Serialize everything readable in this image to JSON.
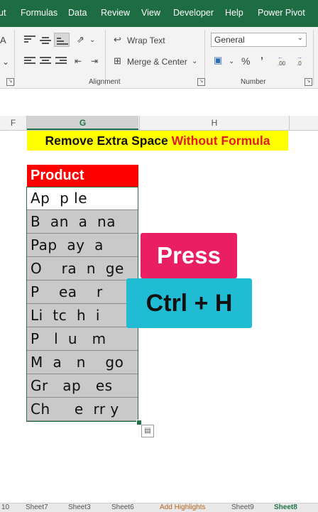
{
  "menu": {
    "tabs": [
      "ut",
      "Formulas",
      "Data",
      "Review",
      "View",
      "Developer",
      "Help",
      "Power Pivot"
    ]
  },
  "ribbon": {
    "wrap_text": "Wrap Text",
    "merge_center": "Merge & Center",
    "number_format": "General",
    "alignment_label": "Alignment",
    "number_label": "Number",
    "font_a": "A",
    "orient_icon": "orientation-icon",
    "percent": "%",
    "comma": "’",
    "inc_dec": ".00",
    "dec_dec": ".0"
  },
  "columns": {
    "f": "F",
    "g": "G",
    "h": "H"
  },
  "title": {
    "part1": "Remove Extra Space",
    "part2": "Without Formula"
  },
  "table": {
    "header": "Product",
    "rows": [
      "Ap  p le",
      "B  an  a  na",
      "Pap  ay  a",
      "O    ra  n  ge",
      "P    ea    r",
      "Li  tc  h  i",
      "P   l  u   m",
      "M  a   n    go",
      "Gr   ap   es",
      "Ch     e  rr y"
    ]
  },
  "overlay": {
    "press": "Press",
    "shortcut": "Ctrl + H"
  },
  "sheet_tabs": [
    "10",
    "Sheet7",
    "Sheet3",
    "Sheet6",
    "Add Highlights",
    "Sheet9",
    "Sheet8"
  ],
  "colors": {
    "excel_green": "#1e6c41",
    "title_bg": "#ffff00",
    "title_red": "#e11b22",
    "header_red": "#ff0000",
    "press_pink": "#e91e63",
    "ctrl_cyan": "#1fbcd3"
  }
}
